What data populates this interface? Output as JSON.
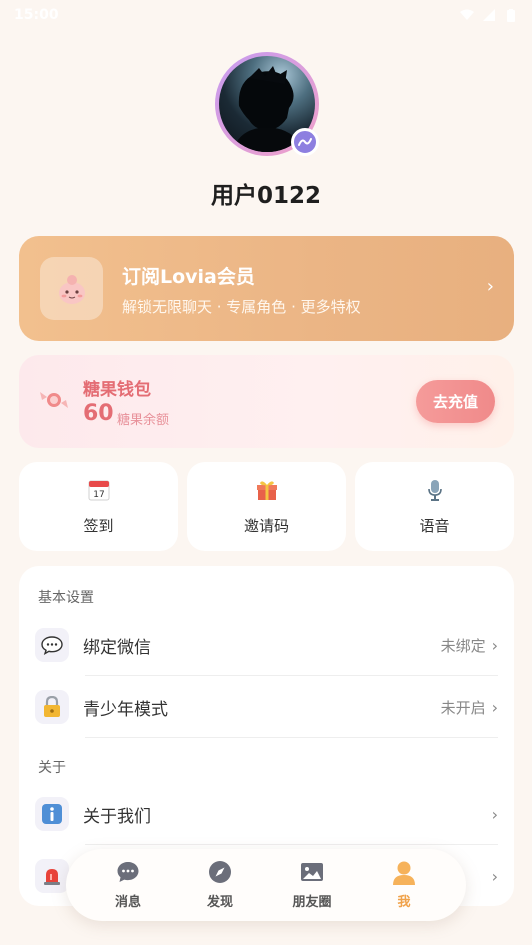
{
  "status_bar": {
    "time": "15:00"
  },
  "profile": {
    "username": "用户0122"
  },
  "vip": {
    "title": "订阅Lovia会员",
    "subtitle": "解锁无限聊天 · 专属角色 · 更多特权",
    "chevron": "›"
  },
  "wallet": {
    "title": "糖果钱包",
    "amount": "60",
    "unit": "糖果余额",
    "button": "去充值"
  },
  "quick_actions": [
    {
      "label": "签到",
      "icon": "calendar-icon"
    },
    {
      "label": "邀请码",
      "icon": "gift-icon"
    },
    {
      "label": "语音",
      "icon": "microphone-icon"
    }
  ],
  "settings": {
    "basic_title": "基本设置",
    "about_title": "关于",
    "rows": [
      {
        "label": "绑定微信",
        "value": "未绑定",
        "icon": "wechat-icon"
      },
      {
        "label": "青少年模式",
        "value": "未开启",
        "icon": "lock-icon"
      },
      {
        "label": "关于我们",
        "value": "",
        "icon": "info-icon"
      }
    ],
    "chevron": "›"
  },
  "bottom_nav": {
    "items": [
      {
        "label": "消息",
        "icon": "chat-icon",
        "active": false
      },
      {
        "label": "发现",
        "icon": "compass-icon",
        "active": false
      },
      {
        "label": "朋友圈",
        "icon": "image-icon",
        "active": false
      },
      {
        "label": "我",
        "icon": "person-icon",
        "active": true
      }
    ]
  },
  "colors": {
    "accent": "#f0a24a",
    "vip_gradient": "#eeb887",
    "wallet_text": "#e46d74",
    "background": "#fcf6f1"
  }
}
